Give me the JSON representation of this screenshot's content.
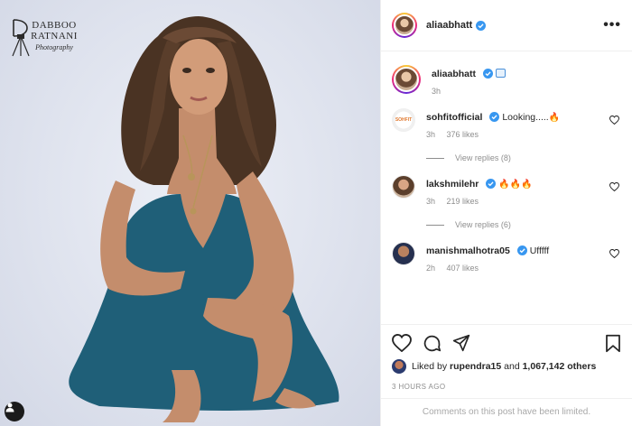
{
  "photo": {
    "watermark_brand": "DABBOO RATNANI",
    "watermark_sub": "Photography",
    "user_tag_icon": "person-icon"
  },
  "post_header": {
    "username": "aliaabhatt",
    "verified": true,
    "more_icon": "more-horizontal-icon",
    "more_label": "•••"
  },
  "caption": {
    "username": "aliaabhatt",
    "text_icon": "blue-square-emoji",
    "time": "3h"
  },
  "comments": [
    {
      "username": "sohfitofficial",
      "text": "Looking.....",
      "emoji": "🔥",
      "time": "3h",
      "likes": "376 likes",
      "replies": "View replies (8)"
    },
    {
      "username": "lakshmilehr",
      "text": "",
      "emoji": "🔥🔥🔥",
      "time": "3h",
      "likes": "219 likes",
      "replies": "View replies (6)"
    },
    {
      "username": "manishmalhotra05",
      "text": "Ufffff",
      "emoji": "",
      "time": "2h",
      "likes": "407 likes",
      "replies": ""
    }
  ],
  "actions": {
    "like_icon": "heart-icon",
    "comment_icon": "comment-icon",
    "share_icon": "share-icon",
    "save_icon": "bookmark-icon"
  },
  "likes": {
    "prefix": "Liked by",
    "user": "rupendra15",
    "middle": "and",
    "count": "1,067,142 others"
  },
  "timestamp": "3 HOURS AGO",
  "comments_limited": "Comments on this post have been limited.",
  "colors": {
    "verified": "#3897f0",
    "muted": "#8e8e8e",
    "text": "#262626"
  }
}
